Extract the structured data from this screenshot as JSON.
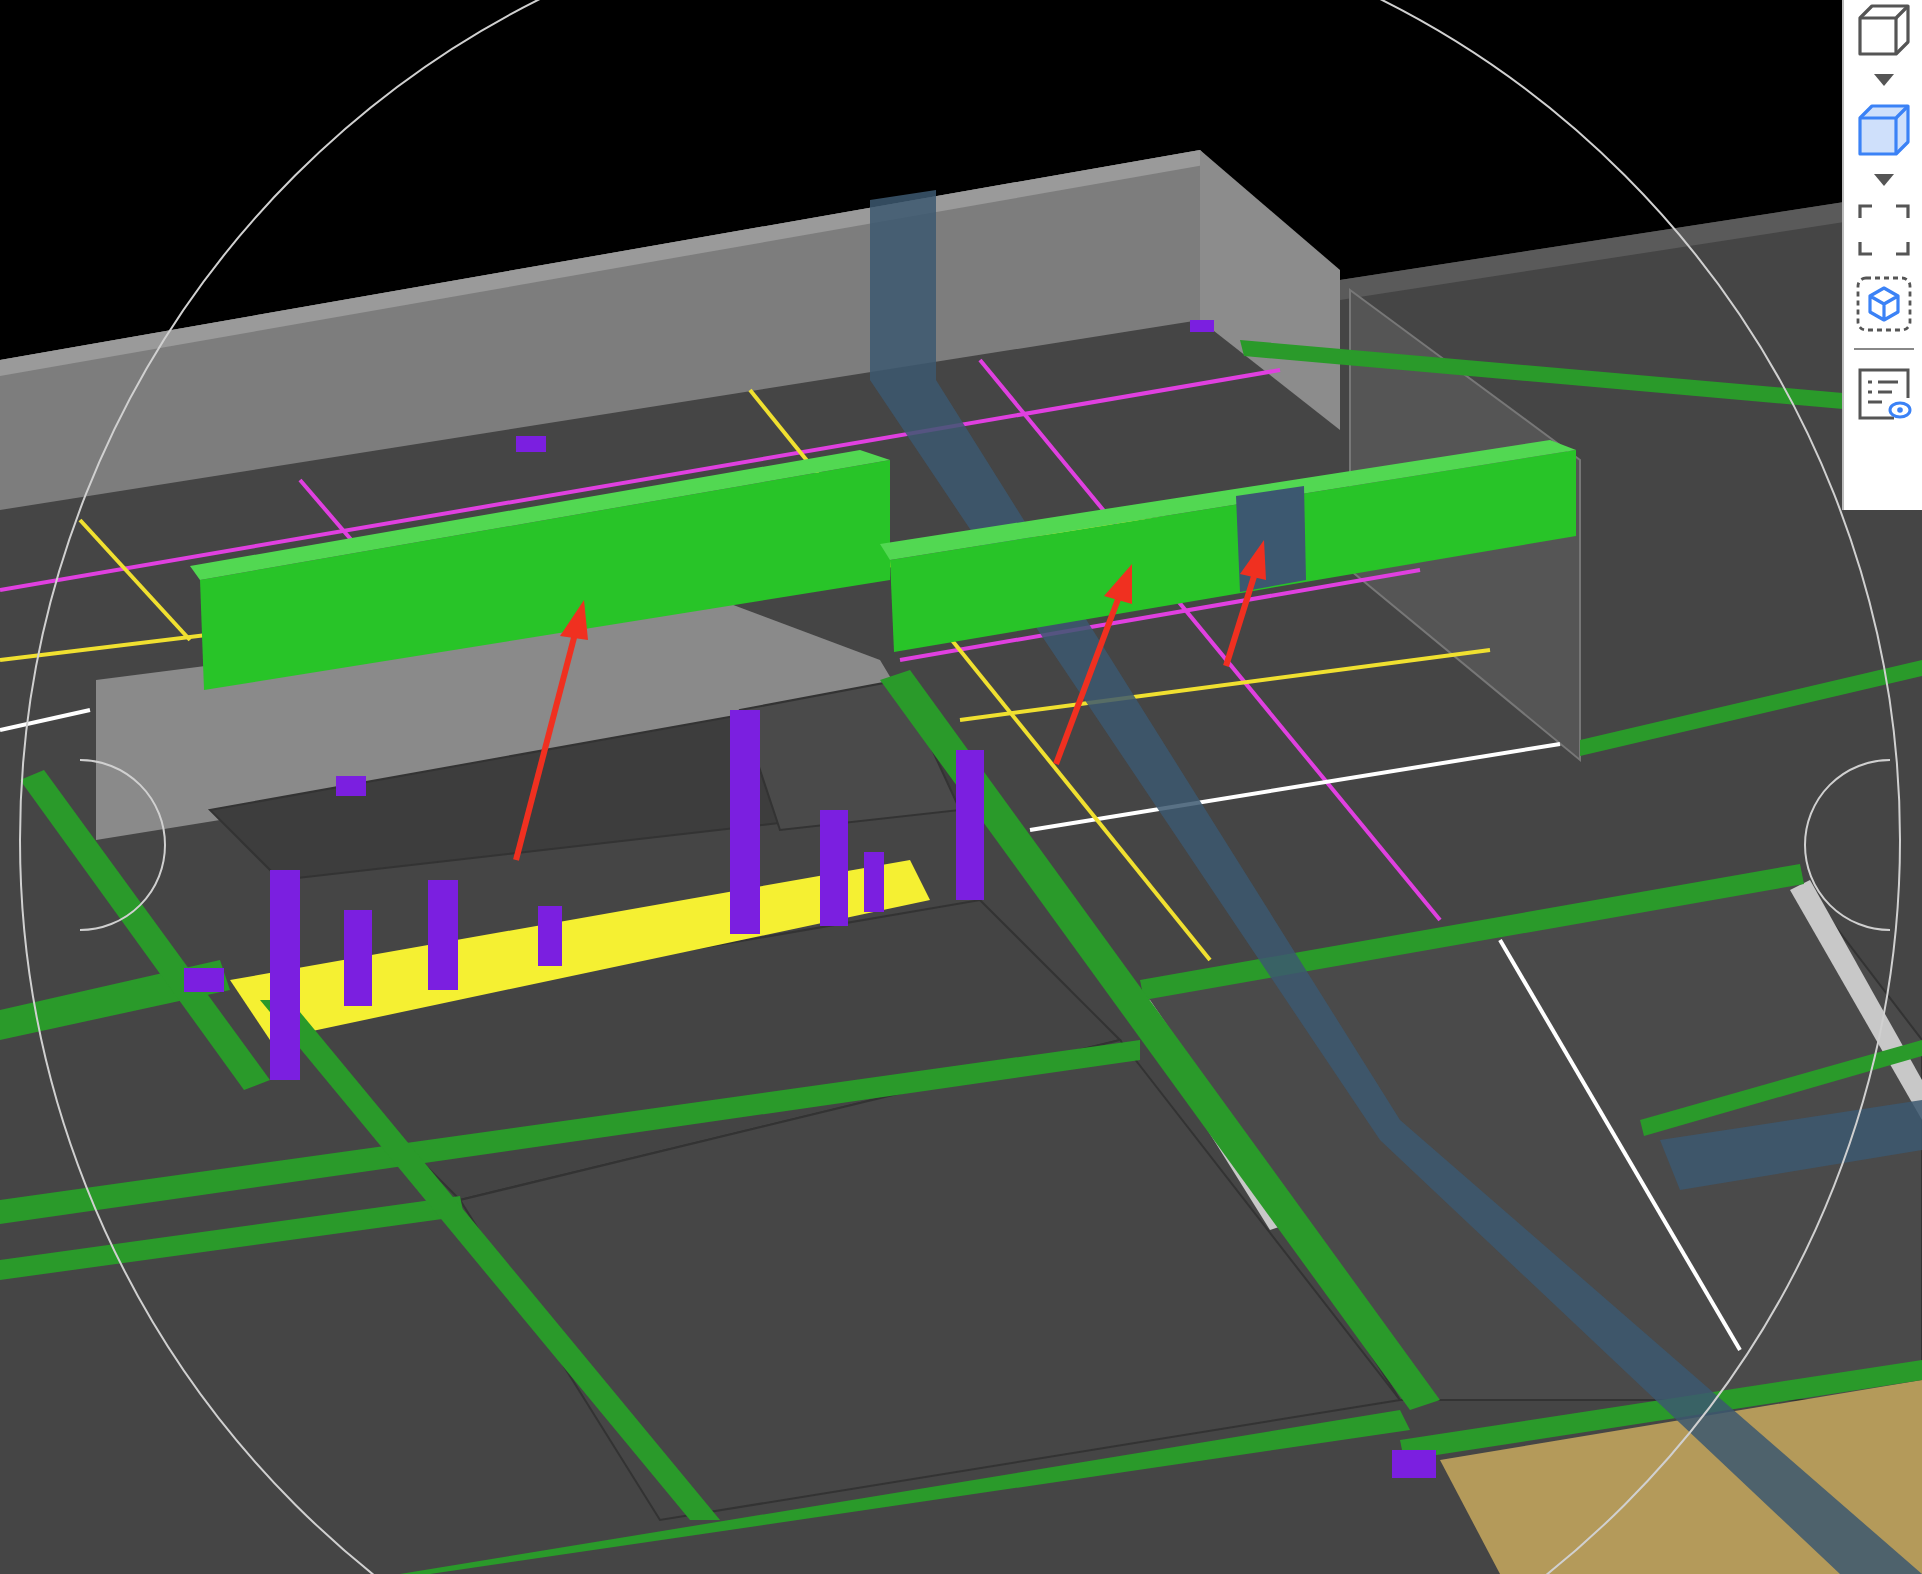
{
  "toolbar": {
    "tools": [
      {
        "kind": "cube-outline",
        "selected": false
      },
      {
        "kind": "dropdown",
        "selected": false
      },
      {
        "kind": "cube",
        "selected": true
      },
      {
        "kind": "dropdown",
        "selected": false
      },
      {
        "kind": "box-select",
        "selected": false
      },
      {
        "kind": "cube-select",
        "selected": false
      },
      {
        "kind": "divider"
      },
      {
        "kind": "properties",
        "selected": false
      }
    ]
  }
}
